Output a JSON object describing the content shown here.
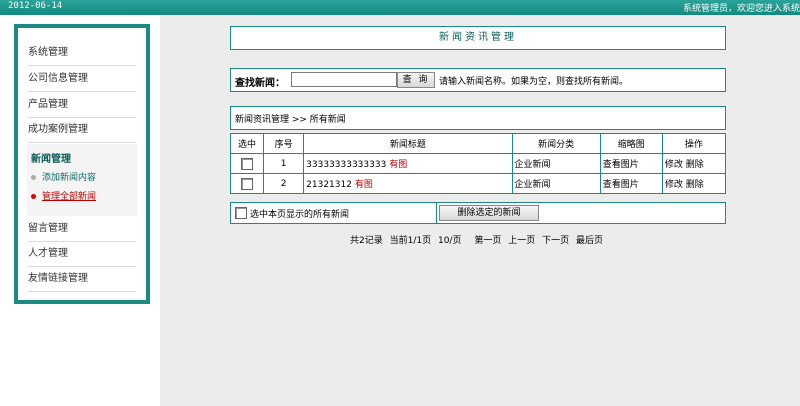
{
  "header": {
    "date": "2012-06-14",
    "welcome": "系统管理员，欢迎您进入系统"
  },
  "sidebar": {
    "items_top": [
      {
        "label": "系统管理"
      },
      {
        "label": "公司信息管理"
      },
      {
        "label": "产品管理"
      },
      {
        "label": "成功案例管理"
      }
    ],
    "section": {
      "title": "新闻管理",
      "children": [
        {
          "label": "添加新闻内容",
          "active": false
        },
        {
          "label": "管理全部新闻",
          "active": true
        }
      ]
    },
    "items_bottom": [
      {
        "label": "留言管理"
      },
      {
        "label": "人才管理"
      },
      {
        "label": "友情链接管理"
      }
    ]
  },
  "main": {
    "panel_title": "新闻资讯管理",
    "search": {
      "label": "查找新闻：",
      "value": "",
      "button": "查 询",
      "hint": "请输入新闻名称。如果为空，则查找所有新闻。"
    },
    "breadcrumb": "新闻资讯管理 >> 所有新闻",
    "table": {
      "headers": [
        "选中",
        "序号",
        "新闻标题",
        "新闻分类",
        "缩略图",
        "操作"
      ],
      "rows": [
        {
          "index": "1",
          "title": "33333333333333",
          "has_image": "有图",
          "category": "企业新闻",
          "thumb": "查看图片",
          "edit": "修改",
          "delete": "删除"
        },
        {
          "index": "2",
          "title": "21321312",
          "has_image": "有图",
          "category": "企业新闻",
          "thumb": "查看图片",
          "edit": "修改",
          "delete": "删除"
        }
      ]
    },
    "bulk": {
      "select_all_label": "选中本页显示的所有新闻",
      "delete_button": "删除选定的新闻"
    },
    "pager": {
      "total": "共2记录",
      "current": "当前1/1页",
      "per_page": "10/页",
      "first": "第一页",
      "prev": "上一页",
      "next": "下一页",
      "last": "最后页"
    }
  }
}
